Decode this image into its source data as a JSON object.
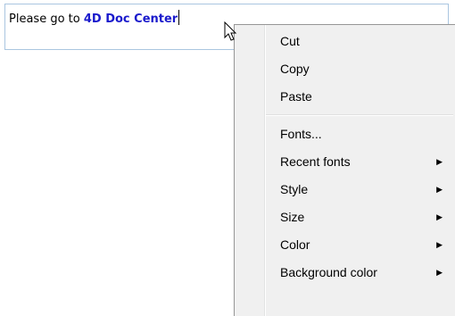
{
  "editor": {
    "text_before": "Please go to ",
    "link_text": "4D Doc Center"
  },
  "context_menu": {
    "items": [
      {
        "label": "Cut",
        "submenu": false
      },
      {
        "label": "Copy",
        "submenu": false
      },
      {
        "label": "Paste",
        "submenu": false
      },
      {
        "label": "Fonts...",
        "submenu": false
      },
      {
        "label": "Recent fonts",
        "submenu": true
      },
      {
        "label": "Style",
        "submenu": true
      },
      {
        "label": "Size",
        "submenu": true
      },
      {
        "label": "Color",
        "submenu": true
      },
      {
        "label": "Background color",
        "submenu": true
      }
    ],
    "submenu_arrow": "▶"
  },
  "colors": {
    "link": "#1a1acc",
    "menu_background": "#f0f0f0",
    "field_border": "#aac6e0"
  },
  "icons": {
    "cursor": "arrow-pointer-icon",
    "submenu": "submenu-arrow-icon"
  }
}
